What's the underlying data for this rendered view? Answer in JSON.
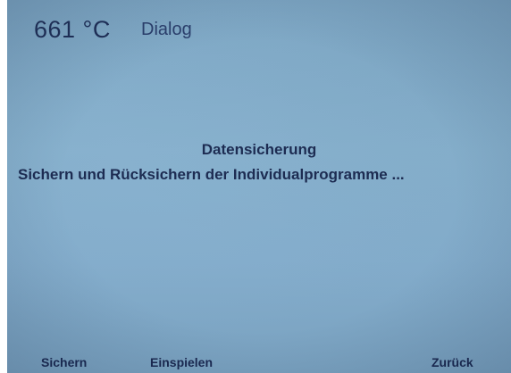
{
  "header": {
    "temperature": "661 °C",
    "mode": "Dialog"
  },
  "dialog": {
    "title": "Datensicherung",
    "message": "Sichern und Rücksichern der Individualprogramme ..."
  },
  "softkeys": {
    "save": "Sichern",
    "load": "Einspielen",
    "back": "Zurück"
  },
  "colors": {
    "screen_background": "#83accb",
    "text": "#1d2c52"
  }
}
